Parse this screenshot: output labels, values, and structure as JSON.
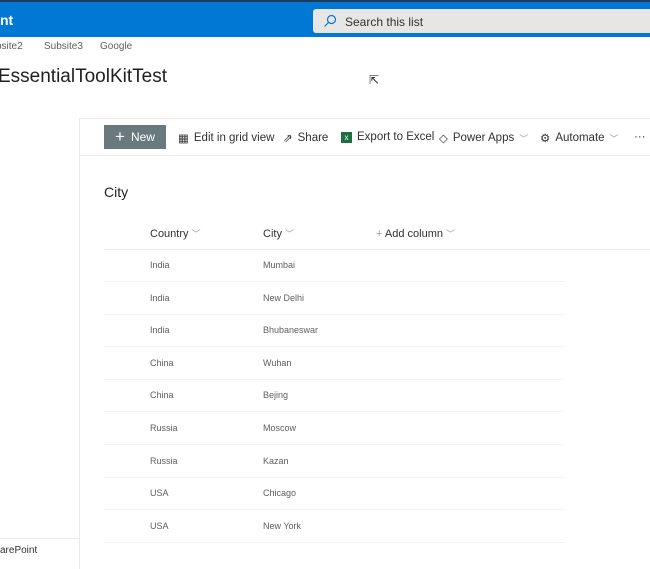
{
  "header": {
    "app_name": "nt",
    "search_placeholder": "Search this list"
  },
  "nav": [
    "bsite2",
    "Subsite3",
    "Google"
  ],
  "site_title": "EssentialToolKitTest",
  "left_footer": "arePoint",
  "commands": {
    "new": "New",
    "grid": "Edit in grid view",
    "share": "Share",
    "export": "Export to Excel",
    "powerapps": "Power Apps",
    "automate": "Automate",
    "more": "···"
  },
  "list": {
    "title": "City",
    "columns": [
      "Country",
      "City"
    ],
    "add_column": "Add column",
    "rows": [
      [
        "India",
        "Mumbai"
      ],
      [
        "India",
        "New Delhi"
      ],
      [
        "India",
        "Bhubaneswar"
      ],
      [
        "China",
        "Wuhan"
      ],
      [
        "China",
        "Bejing"
      ],
      [
        "Russia",
        "Moscow"
      ],
      [
        "Russia",
        "Kazan"
      ],
      [
        "USA",
        "Chicago"
      ],
      [
        "USA",
        "New York"
      ]
    ]
  },
  "colors": {
    "brand": "#0078d4",
    "new_button": "#69797e"
  }
}
